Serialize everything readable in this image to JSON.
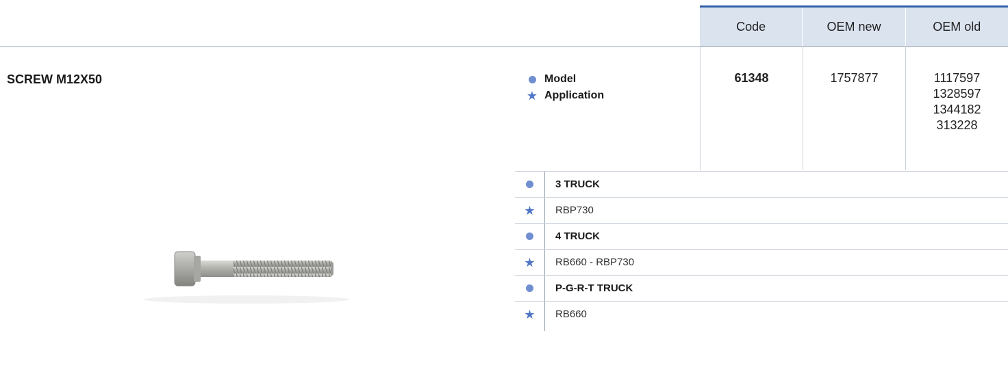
{
  "table_header": {
    "code": "Code",
    "oem_new": "OEM new",
    "oem_old": "OEM old"
  },
  "product": {
    "title": "SCREW M12X50"
  },
  "legend": {
    "model": "Model",
    "application": "Application"
  },
  "codes": {
    "code": "61348",
    "oem_new": "1757877",
    "oem_old": [
      "1117597",
      "1328597",
      "1344182",
      "313228"
    ]
  },
  "applications": [
    {
      "model": "3 TRUCK",
      "application": "RBP730"
    },
    {
      "model": "4 TRUCK",
      "application": "RB660 - RBP730"
    },
    {
      "model": "P-G-R-T TRUCK",
      "application": "RB660"
    }
  ],
  "colors": {
    "accent": "#2f5fa8",
    "header_bg": "#dbe3ef",
    "icon": "#6f8fd0"
  },
  "icons": {
    "model": "dot-icon",
    "application": "star-icon"
  }
}
